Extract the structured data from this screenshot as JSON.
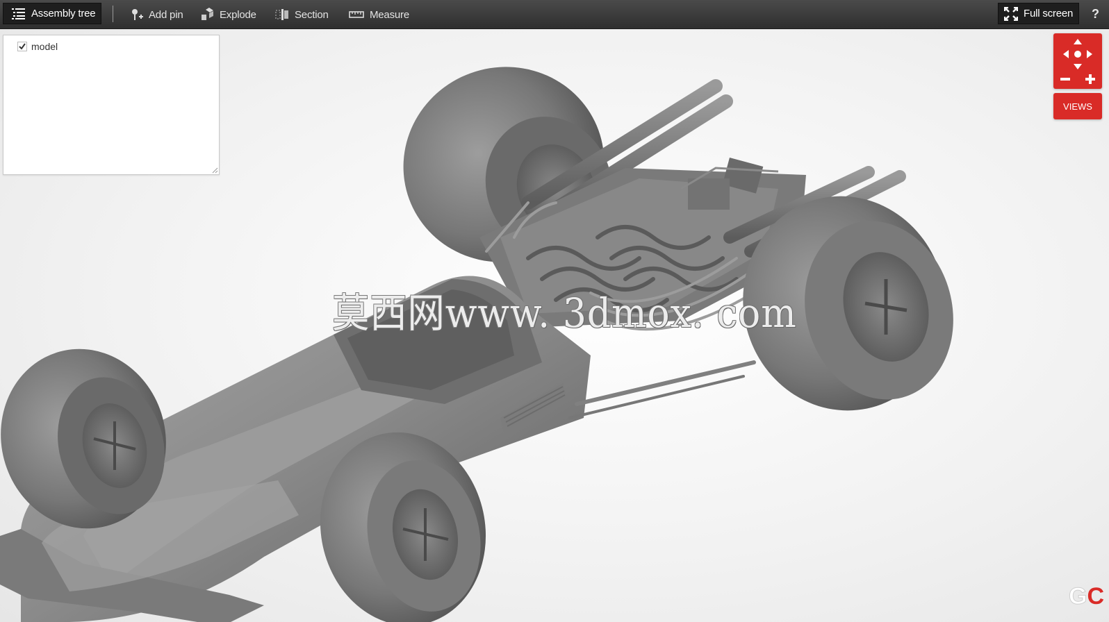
{
  "toolbar": {
    "assembly_tree": "Assembly tree",
    "add_pin": "Add pin",
    "explode": "Explode",
    "section": "Section",
    "measure": "Measure",
    "full_screen": "Full screen",
    "help": "?"
  },
  "tree": {
    "nodes": [
      {
        "label": "model",
        "checked": true
      }
    ]
  },
  "navigation": {
    "views_label": "VIEWS"
  },
  "watermark": "莫西网www. 3dmox. com",
  "logo_text": "GC",
  "colors": {
    "toolbar_bg": "#3a3a3a",
    "accent_red": "#d92b27",
    "model_gray": "#8c8c8c"
  },
  "icons": [
    "list-icon",
    "pin-icon",
    "explode-icon",
    "section-icon",
    "ruler-icon",
    "fullscreen-icon",
    "check-icon",
    "pan-arrows-icon",
    "zoom-out-icon",
    "zoom-in-icon"
  ]
}
